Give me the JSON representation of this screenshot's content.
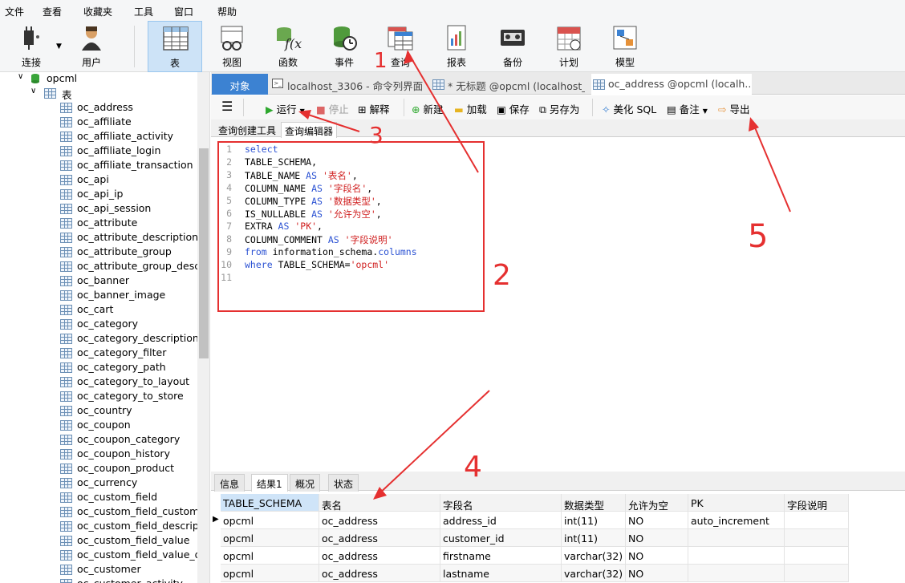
{
  "menu": [
    "文件",
    "查看",
    "收藏夹",
    "工具",
    "窗口",
    "帮助"
  ],
  "toolbar": {
    "connect": "连接",
    "user": "用户",
    "table": "表",
    "view": "视图",
    "function": "函数",
    "event": "事件",
    "query": "查询",
    "report": "报表",
    "backup": "备份",
    "schedule": "计划",
    "model": "模型"
  },
  "tree": {
    "db": "opcml",
    "group": "表",
    "tables": [
      "oc_address",
      "oc_affiliate",
      "oc_affiliate_activity",
      "oc_affiliate_login",
      "oc_affiliate_transaction",
      "oc_api",
      "oc_api_ip",
      "oc_api_session",
      "oc_attribute",
      "oc_attribute_description",
      "oc_attribute_group",
      "oc_attribute_group_descri",
      "oc_banner",
      "oc_banner_image",
      "oc_cart",
      "oc_category",
      "oc_category_description",
      "oc_category_filter",
      "oc_category_path",
      "oc_category_to_layout",
      "oc_category_to_store",
      "oc_country",
      "oc_coupon",
      "oc_coupon_category",
      "oc_coupon_history",
      "oc_coupon_product",
      "oc_currency",
      "oc_custom_field",
      "oc_custom_field_customer",
      "oc_custom_field_descriptio",
      "oc_custom_field_value",
      "oc_custom_field_value_des",
      "oc_customer",
      "oc_customer_activity"
    ]
  },
  "tabs": {
    "objects": "对象",
    "tab1": "localhost_3306 - 命令列界面",
    "tab2": "* 无标题 @opcml (localhost_...",
    "tab3": "oc_address @opcml (localh..."
  },
  "editor_toolbar": {
    "run": "运行",
    "stop": "停止",
    "explain": "解释",
    "new": "新建",
    "load": "加载",
    "save": "保存",
    "save_as": "另存为",
    "beautify": "美化 SQL",
    "comment": "备注",
    "export": "导出"
  },
  "subtabs": {
    "builder": "查询创建工具",
    "editor": "查询编辑器"
  },
  "code": [
    {
      "n": "1",
      "parts": [
        [
          "kw",
          "select"
        ]
      ]
    },
    {
      "n": "2",
      "parts": [
        [
          "t",
          "TABLE_SCHEMA,"
        ]
      ]
    },
    {
      "n": "3",
      "parts": [
        [
          "t",
          "TABLE_NAME "
        ],
        [
          "kw",
          "AS"
        ],
        [
          "t",
          " "
        ],
        [
          "str",
          "'表名'"
        ],
        [
          "t",
          ","
        ]
      ]
    },
    {
      "n": "4",
      "parts": [
        [
          "t",
          "COLUMN_NAME "
        ],
        [
          "kw",
          "AS"
        ],
        [
          "t",
          " "
        ],
        [
          "str",
          "'字段名'"
        ],
        [
          "t",
          ","
        ]
      ]
    },
    {
      "n": "5",
      "parts": [
        [
          "t",
          "COLUMN_TYPE "
        ],
        [
          "kw",
          "AS"
        ],
        [
          "t",
          " "
        ],
        [
          "str",
          "'数据类型'"
        ],
        [
          "t",
          ","
        ]
      ]
    },
    {
      "n": "6",
      "parts": [
        [
          "t",
          "IS_NULLABLE "
        ],
        [
          "kw",
          "AS"
        ],
        [
          "t",
          " "
        ],
        [
          "str",
          "'允许为空'"
        ],
        [
          "t",
          ","
        ]
      ]
    },
    {
      "n": "7",
      "parts": [
        [
          "t",
          "EXTRA "
        ],
        [
          "kw",
          "AS"
        ],
        [
          "t",
          " "
        ],
        [
          "str",
          "'PK'"
        ],
        [
          "t",
          ","
        ]
      ]
    },
    {
      "n": "8",
      "parts": [
        [
          "t",
          "COLUMN_COMMENT "
        ],
        [
          "kw",
          "AS"
        ],
        [
          "t",
          " "
        ],
        [
          "str",
          "'字段说明'"
        ]
      ]
    },
    {
      "n": "9",
      "parts": [
        [
          "kw",
          "from"
        ],
        [
          "t",
          " information_schema."
        ],
        [
          "kw",
          "columns"
        ]
      ]
    },
    {
      "n": "10",
      "parts": [
        [
          "kw",
          "where"
        ],
        [
          "t",
          " TABLE_SCHEMA="
        ],
        [
          "str",
          "'opcml'"
        ]
      ]
    },
    {
      "n": "11",
      "parts": []
    }
  ],
  "result_tabs": [
    "信息",
    "结果1",
    "概况",
    "状态"
  ],
  "grid": {
    "headers": [
      "TABLE_SCHEMA",
      "表名",
      "字段名",
      "数据类型",
      "允许为空",
      "PK",
      "字段说明"
    ],
    "rows": [
      [
        "opcml",
        "oc_address",
        "address_id",
        "int(11)",
        "NO",
        "auto_increment",
        ""
      ],
      [
        "opcml",
        "oc_address",
        "customer_id",
        "int(11)",
        "NO",
        "",
        ""
      ],
      [
        "opcml",
        "oc_address",
        "firstname",
        "varchar(32)",
        "NO",
        "",
        ""
      ],
      [
        "opcml",
        "oc_address",
        "lastname",
        "varchar(32)",
        "NO",
        "",
        ""
      ]
    ]
  },
  "annotations": [
    "1",
    "2",
    "3",
    "4",
    "5"
  ],
  "colors": {
    "accent": "#3c82d2",
    "annotation": "#e53030",
    "keyword": "#2b52d3",
    "string": "#d02020"
  }
}
